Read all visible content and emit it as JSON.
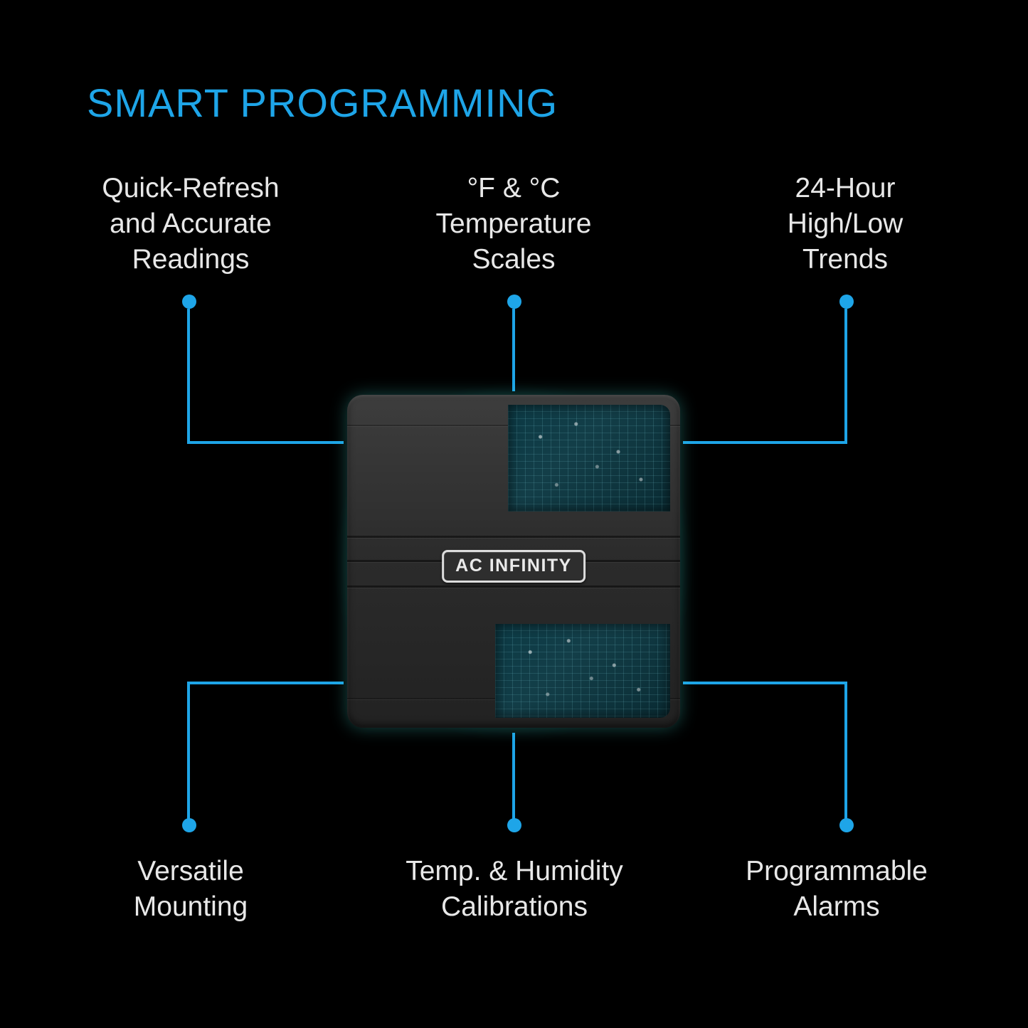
{
  "title": "SMART PROGRAMMING",
  "features": {
    "top_left": "Quick-Refresh\nand Accurate\nReadings",
    "top_center": "°F & °C\nTemperature\nScales",
    "top_right": "24-Hour\nHigh/Low\nTrends",
    "bottom_left": "Versatile\nMounting",
    "bottom_center": "Temp. & Humidity\nCalibrations",
    "bottom_right": "Programmable\nAlarms"
  },
  "device": {
    "brand": "AC INFINITY"
  },
  "colors": {
    "accent": "#1ea5e8",
    "glow": "#3ed2c8"
  }
}
